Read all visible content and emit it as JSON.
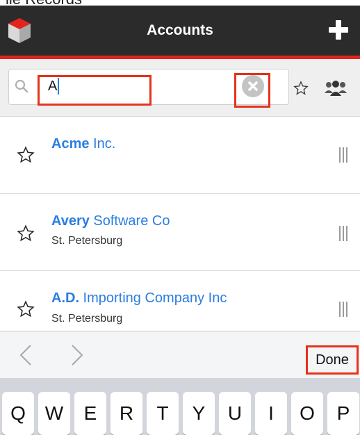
{
  "cropped_strip": "ile Records",
  "header": {
    "title": "Accounts",
    "logo_icon": "cube-logo-icon",
    "add_icon": "plus-icon"
  },
  "search": {
    "value": "A",
    "clear_icon": "clear-circle-x-icon",
    "favorites_icon": "star-outline-icon",
    "my_items_icon": "group-people-icon"
  },
  "accounts": [
    {
      "match": "Acme",
      "rest": " Inc.",
      "city": ""
    },
    {
      "match": "Avery",
      "rest": " Software Co",
      "city": "St. Petersburg"
    },
    {
      "match": "A.D.",
      "rest": " Importing Company Inc",
      "city": "St. Petersburg"
    }
  ],
  "keyboard_toolbar": {
    "done_label": "Done",
    "prev_icon": "chevron-left-icon",
    "next_icon": "chevron-right-icon"
  },
  "keyboard": {
    "keys": [
      "Q",
      "W",
      "E",
      "R",
      "T",
      "Y",
      "U",
      "I",
      "O",
      "P"
    ]
  },
  "colors": {
    "header_bg": "#2b2b2b",
    "accent_red": "#e4241b",
    "link_blue": "#2a7de1"
  }
}
